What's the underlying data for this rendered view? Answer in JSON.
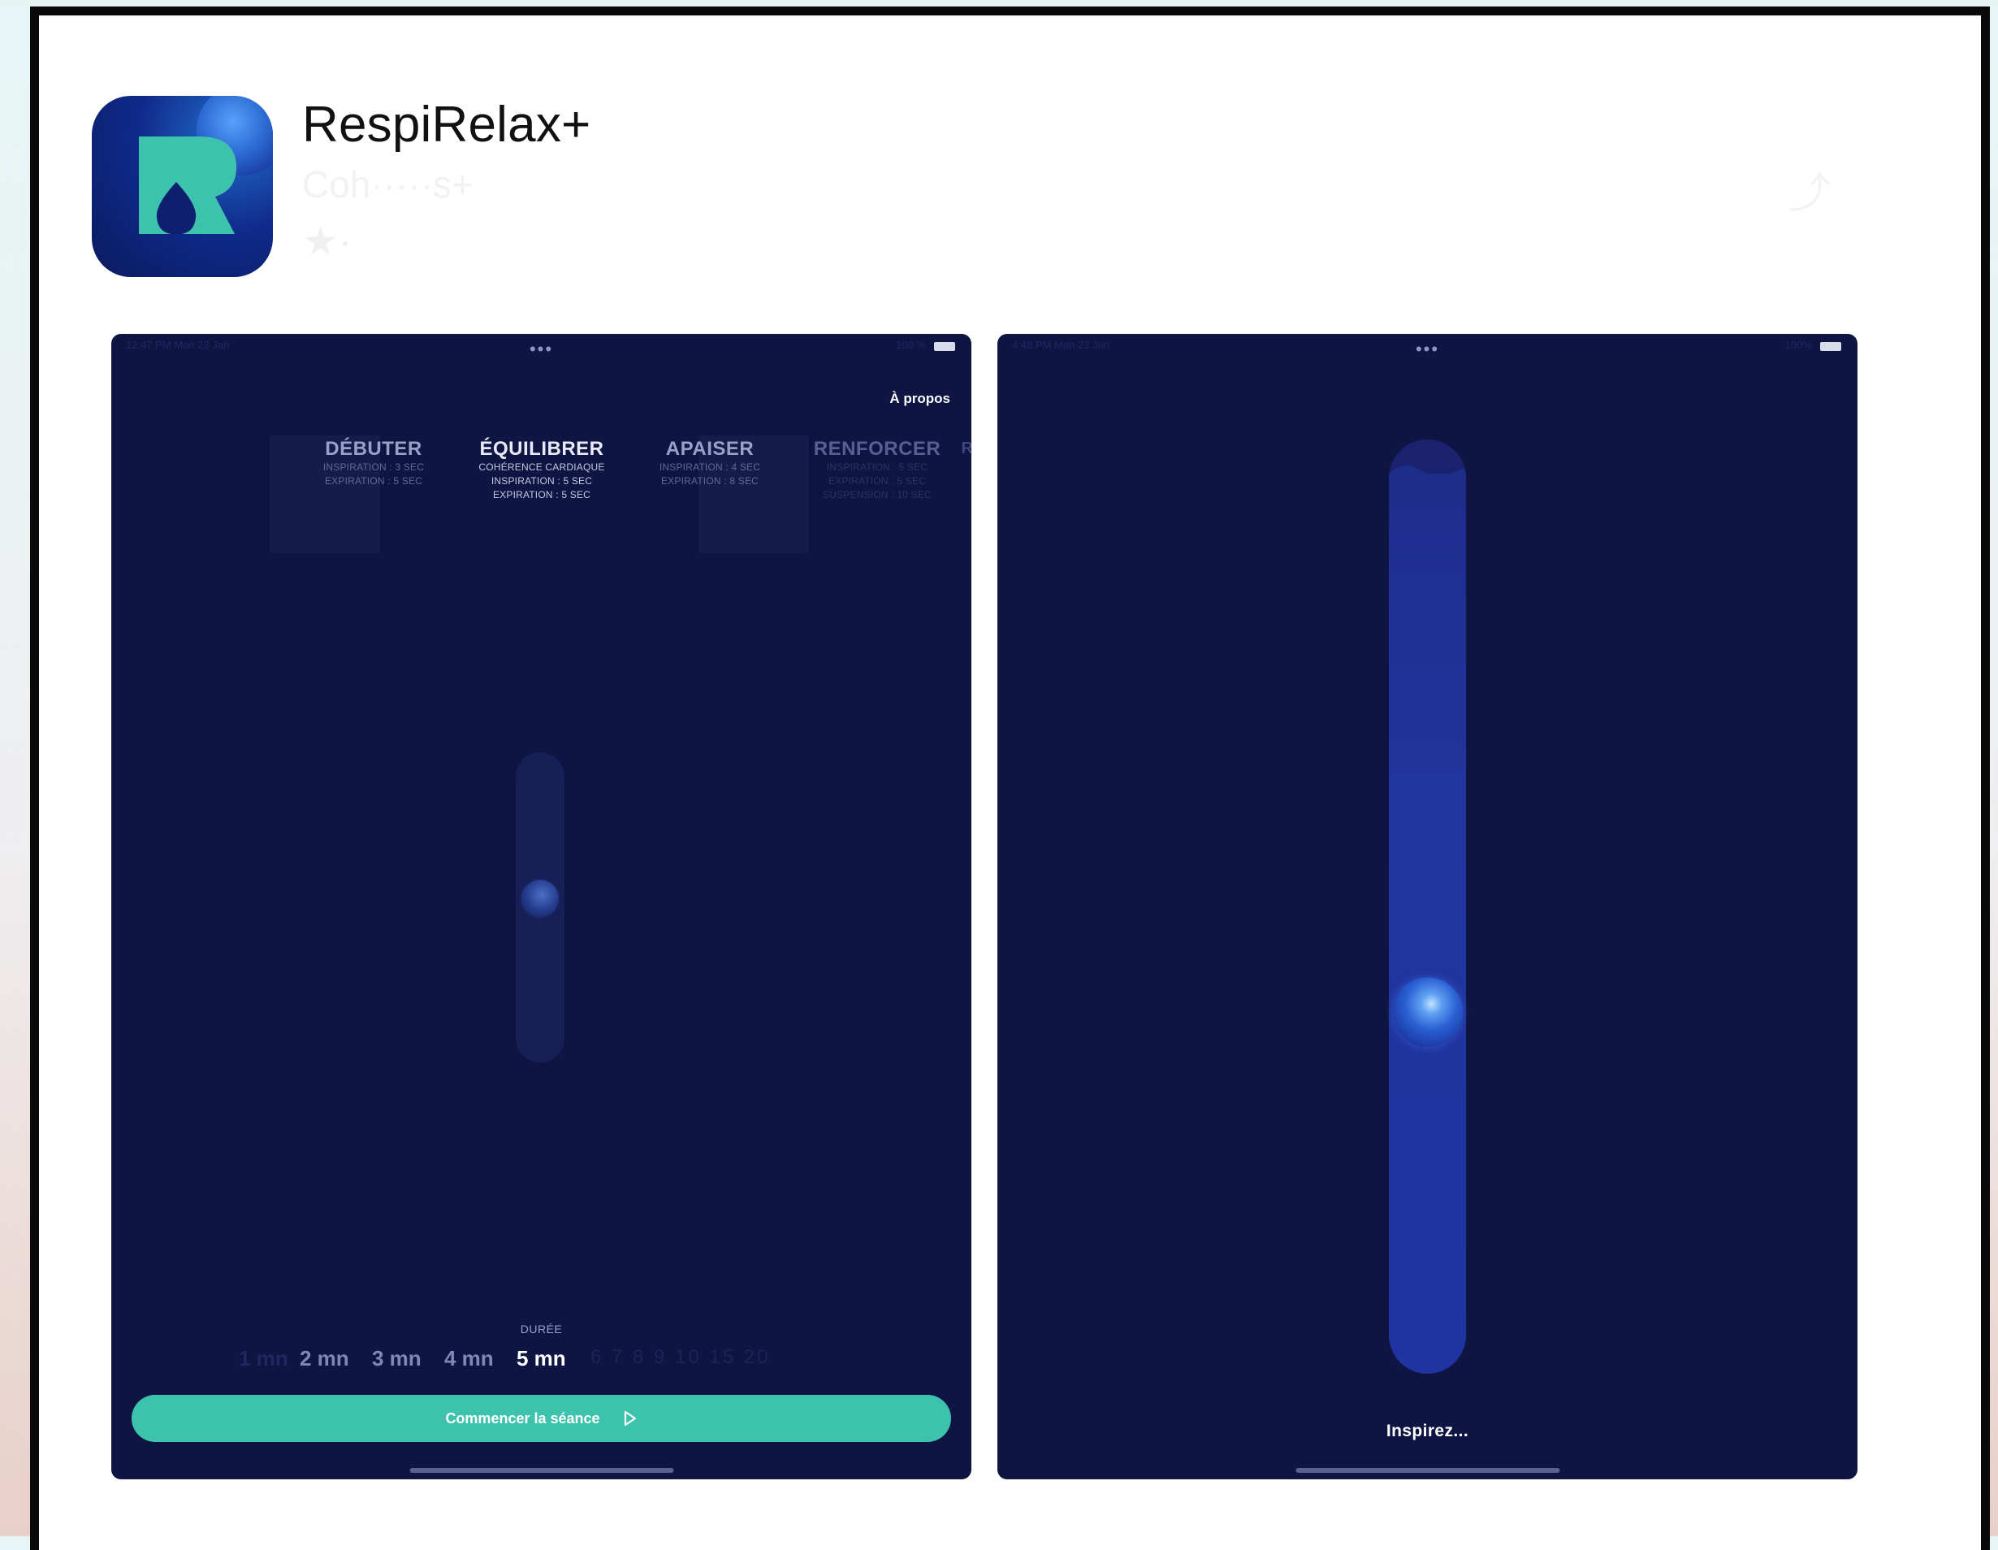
{
  "app": {
    "name": "RespiRelax+",
    "subtitle_faded": "Coh·····s+",
    "rating_faded": "★·",
    "share_faded": "⤴"
  },
  "colors": {
    "screen_bg": "#0e1542",
    "accent": "#3dc2ad",
    "icon_letter": "#3dc2ad"
  },
  "screenshot1": {
    "status_time": "12:47 PM  Mon 23 Jan",
    "status_right": "100 %",
    "status_dots": "•••",
    "about_label": "À propos",
    "modes": [
      {
        "title": "DÉBUTER",
        "lines": [
          "INSPIRATION : 3 SEC",
          "EXPIRATION : 5 SEC"
        ]
      },
      {
        "title": "ÉQUILIBRER",
        "lines": [
          "COHÉRENCE CARDIAQUE",
          "INSPIRATION : 5 SEC",
          "EXPIRATION : 5 SEC"
        ]
      },
      {
        "title": "APAISER",
        "lines": [
          "INSPIRATION : 4 SEC",
          "EXPIRATION : 8 SEC"
        ]
      },
      {
        "title": "RENFORCER",
        "lines": [
          "INSPIRATION : 5 SEC",
          "EXPIRATION : 5 SEC",
          "SUSPENSION : 10 SEC"
        ]
      }
    ],
    "edge_letter": "R",
    "duration_label": "DURÉE",
    "durations": [
      "1 mn",
      "2 mn",
      "3 mn",
      "4 mn",
      "5 mn"
    ],
    "durations_faint": "6  7  8  9  10 15 20",
    "selected_duration": "5 mn",
    "start_button": "Commencer la séance"
  },
  "screenshot2": {
    "status_time": "4:48 PM  Mon 23 Jan",
    "status_right": "100%",
    "status_dots": "•••",
    "prompt": "Inspirez..."
  }
}
